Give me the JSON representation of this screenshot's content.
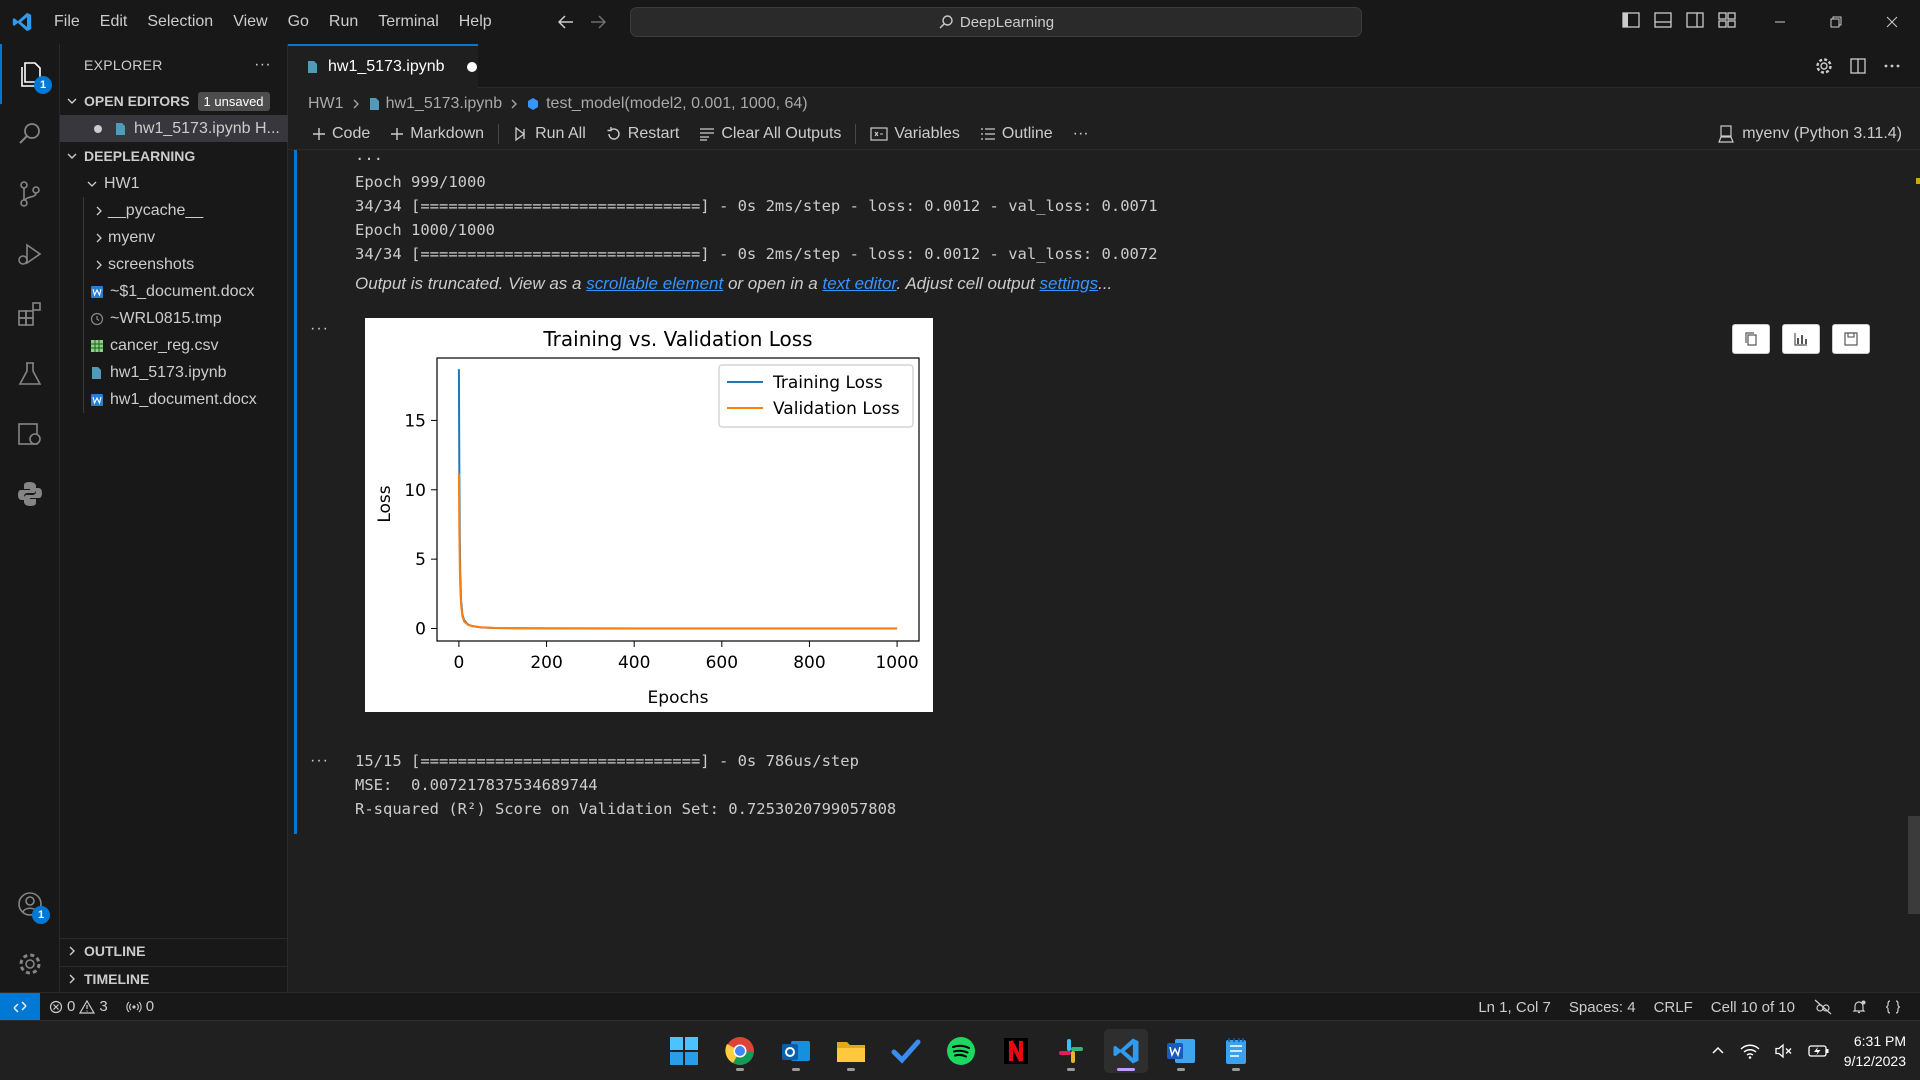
{
  "window": {
    "menu": [
      "File",
      "Edit",
      "Selection",
      "View",
      "Go",
      "Run",
      "Terminal",
      "Help"
    ],
    "search_text": "DeepLearning"
  },
  "activity": {
    "explorer_badge": "1",
    "accounts_badge": "1"
  },
  "sidebar": {
    "title": "EXPLORER",
    "more": "···",
    "open_editors_label": "OPEN EDITORS",
    "unsaved_badge": "1 unsaved",
    "open_editor_item": "hw1_5173.ipynb  H...",
    "workspace_label": "DEEPLEARNING",
    "folder": "HW1",
    "children": [
      {
        "name": "__pycache__",
        "kind": "folder"
      },
      {
        "name": "myenv",
        "kind": "folder"
      },
      {
        "name": "screenshots",
        "kind": "folder"
      },
      {
        "name": "~$1_document.docx",
        "kind": "word"
      },
      {
        "name": "~WRL0815.tmp",
        "kind": "tmp"
      },
      {
        "name": "cancer_reg.csv",
        "kind": "csv"
      },
      {
        "name": "hw1_5173.ipynb",
        "kind": "notebook"
      },
      {
        "name": "hw1_document.docx",
        "kind": "word"
      }
    ],
    "outline_label": "OUTLINE",
    "timeline_label": "TIMELINE"
  },
  "editor": {
    "tab_label": "hw1_5173.ipynb",
    "breadcrumb": [
      "HW1",
      "hw1_5173.ipynb",
      "test_model(model2, 0.001, 1000, 64)"
    ],
    "toolbar": {
      "code": "Code",
      "markdown": "Markdown",
      "run_all": "Run All",
      "restart": "Restart",
      "clear": "Clear All Outputs",
      "variables": "Variables",
      "outline": "Outline",
      "more": "···",
      "kernel": "myenv (Python 3.11.4)"
    }
  },
  "output": {
    "lines_top": [
      "...",
      "Epoch 999/1000",
      "34/34 [==============================] - 0s 2ms/step - loss: 0.0012 - val_loss: 0.0071",
      "Epoch 1000/1000",
      "34/34 [==============================] - 0s 2ms/step - loss: 0.0012 - val_loss: 0.0072"
    ],
    "truncated": {
      "prefix": "Output is truncated. View as a ",
      "link1": "scrollable element",
      "middle": " or open in a ",
      "link2": "text editor",
      "middle2": ". Adjust cell output ",
      "link3": "settings",
      "suffix": "..."
    },
    "ellipsis": "···",
    "lines_bottom": [
      "15/15 [==============================] - 0s 786us/step",
      "MSE:  0.007217837534689744",
      "R-squared (R²) Score on Validation Set: 0.7253020799057808"
    ]
  },
  "chart_data": {
    "type": "line",
    "title": "Training vs. Validation Loss",
    "xlabel": "Epochs",
    "ylabel": "Loss",
    "xlim": [
      -50,
      1050
    ],
    "ylim": [
      -0.9,
      19.5
    ],
    "xticks": [
      0,
      200,
      400,
      600,
      800,
      1000
    ],
    "yticks": [
      0,
      5,
      10,
      15
    ],
    "legend_position": "upper right",
    "series": [
      {
        "name": "Training Loss",
        "color": "#1f77b4",
        "x": [
          0,
          1,
          2,
          3,
          5,
          8,
          12,
          20,
          30,
          50,
          80,
          120,
          200,
          400,
          600,
          800,
          1000
        ],
        "y": [
          18.7,
          11.0,
          6.5,
          4.0,
          2.0,
          1.0,
          0.6,
          0.3,
          0.18,
          0.08,
          0.04,
          0.02,
          0.01,
          0.003,
          0.002,
          0.0015,
          0.0012
        ]
      },
      {
        "name": "Validation Loss",
        "color": "#ff7f0e",
        "x": [
          0,
          1,
          2,
          3,
          5,
          8,
          12,
          20,
          30,
          50,
          80,
          120,
          200,
          400,
          600,
          800,
          1000
        ],
        "y": [
          11.2,
          7.0,
          4.5,
          3.0,
          1.7,
          0.9,
          0.5,
          0.28,
          0.17,
          0.09,
          0.05,
          0.03,
          0.015,
          0.009,
          0.008,
          0.0075,
          0.0072
        ]
      }
    ]
  },
  "status": {
    "errors": "0",
    "warnings": "3",
    "ports": "0",
    "cursor": "Ln 1, Col 7",
    "spaces": "Spaces: 4",
    "eol": "CRLF",
    "cell": "Cell 10 of 10"
  },
  "taskbar": {
    "time": "6:31 PM",
    "date": "9/12/2023"
  },
  "colors": {
    "accent": "#0078d4",
    "link": "#3794ff",
    "training": "#1f77b4",
    "validation": "#ff7f0e"
  }
}
